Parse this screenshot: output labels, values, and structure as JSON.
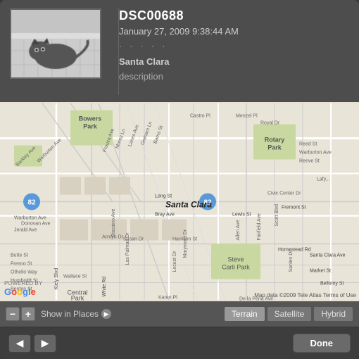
{
  "photo": {
    "title": "DSC00688",
    "date": "January 27, 2009 9:38:44 AM",
    "dots": "· · · · ·",
    "location": "Santa Clara",
    "description": "description"
  },
  "map": {
    "center_label": "Santa Clara",
    "zoom_minus": "−",
    "zoom_plus": "+",
    "show_in_places": "Show in Places",
    "show_in_places_icon": "▶",
    "type_buttons": [
      {
        "label": "Terrain",
        "active": true
      },
      {
        "label": "Satellite",
        "active": false
      },
      {
        "label": "Hybrid",
        "active": false
      }
    ],
    "powered_by": "POWERED BY",
    "google_text": "Google",
    "copyright": "Map data ©2009 Tele Atlas   Terms of Use"
  },
  "nav": {
    "back_icon": "◀",
    "forward_icon": "▶",
    "done_label": "Done"
  }
}
